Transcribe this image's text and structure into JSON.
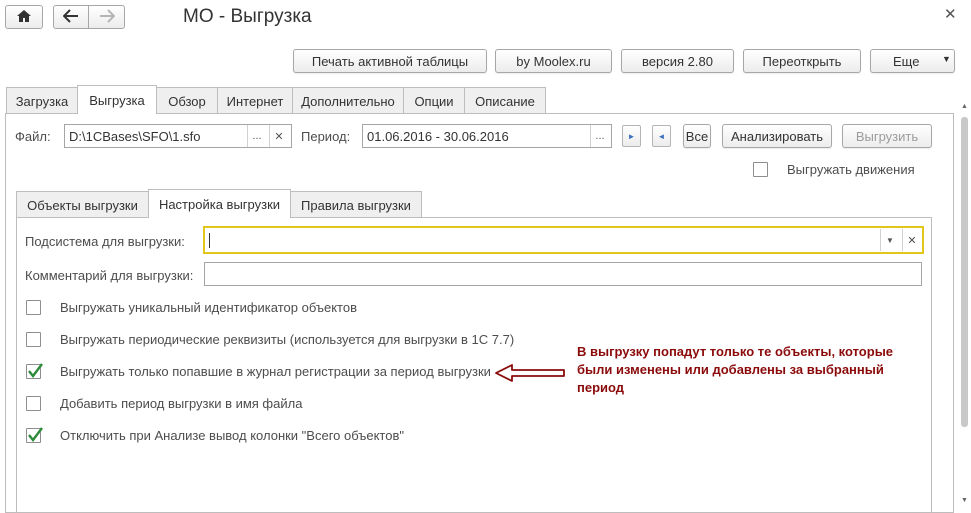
{
  "window": {
    "title": "МО - Выгрузка"
  },
  "toolbar": {
    "print_label": "Печать активной таблицы",
    "author_label": "by Moolex.ru",
    "version_label": "версия 2.80",
    "reopen_label": "Переоткрыть",
    "more_label": "Еще"
  },
  "main_tabs": [
    "Загрузка",
    "Выгрузка",
    "Обзор",
    "Интернет",
    "Дополнительно",
    "Опции",
    "Описание"
  ],
  "file": {
    "label": "Файл:",
    "value": "D:\\1CBases\\SFO\\1.sfo"
  },
  "period": {
    "label": "Период:",
    "value": "01.06.2016 - 30.06.2016",
    "all_label": "Все"
  },
  "actions": {
    "analyze_label": "Анализировать",
    "export_label": "Выгрузить"
  },
  "export_movements": {
    "label": "Выгружать движения",
    "checked": false
  },
  "sub_tabs": [
    "Объекты выгрузки",
    "Настройка выгрузки",
    "Правила выгрузки"
  ],
  "settings": {
    "subsystem_label": "Подсистема для выгрузки:",
    "subsystem_value": "",
    "comment_label": "Комментарий для выгрузки:",
    "comment_value": "",
    "options": [
      {
        "label": "Выгружать уникальный идентификатор объектов",
        "checked": false
      },
      {
        "label": "Выгружать периодические реквизиты (используется для выгрузки в 1С 7.7)",
        "checked": false
      },
      {
        "label": "Выгружать только попавшие в журнал регистрации за период выгрузки",
        "checked": true
      },
      {
        "label": "Добавить период выгрузки в имя файла",
        "checked": false
      },
      {
        "label": "Отключить при Анализе вывод колонки \"Всего объектов\"",
        "checked": true
      }
    ]
  },
  "annotation": {
    "text": "В выгрузку попадут только те объекты, которые были изменены или добавлены за выбранный период",
    "color": "#8b0a0a"
  },
  "colors": {
    "accent_check": "#2e8b3a",
    "focus_border": "#e3c619"
  }
}
